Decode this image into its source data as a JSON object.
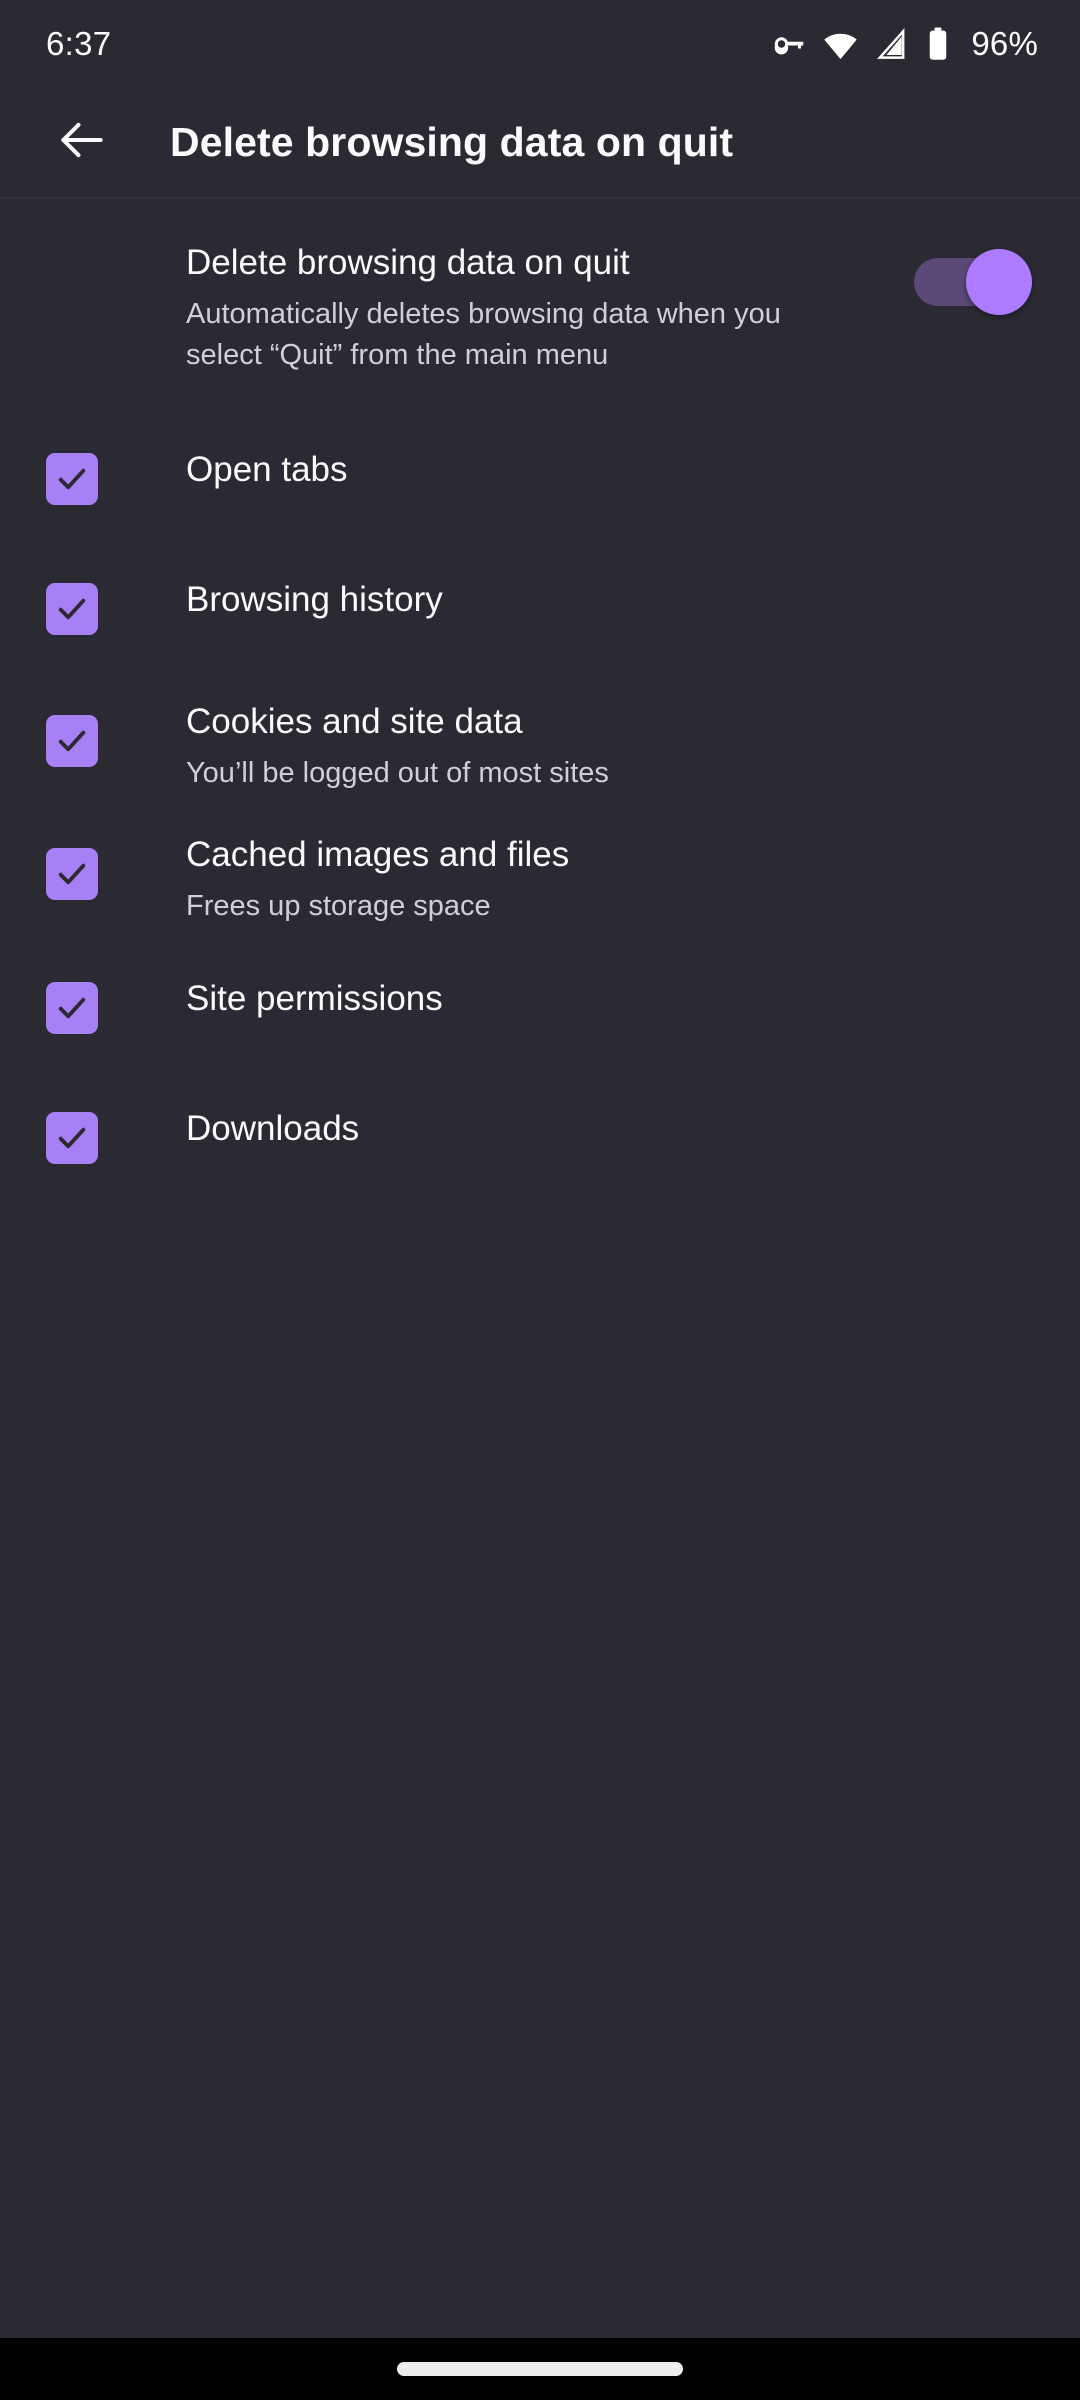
{
  "status_bar": {
    "time": "6:37",
    "battery_percent": "96%",
    "icons": [
      "vpn-key-icon",
      "wifi-icon",
      "cellular-signal-icon",
      "battery-icon"
    ]
  },
  "app_bar": {
    "back_label": "back-arrow",
    "title": "Delete browsing data on quit"
  },
  "master_switch": {
    "title": "Delete browsing data on quit",
    "subtitle": "Automatically deletes browsing data when you select “Quit” from the main menu",
    "enabled": true
  },
  "items": [
    {
      "title": "Open tabs",
      "subtitle": "",
      "checked": true
    },
    {
      "title": "Browsing history",
      "subtitle": "",
      "checked": true
    },
    {
      "title": "Cookies and site data",
      "subtitle": "You’ll be logged out of most sites",
      "checked": true
    },
    {
      "title": "Cached images and files",
      "subtitle": "Frees up storage space",
      "checked": true
    },
    {
      "title": "Site permissions",
      "subtitle": "",
      "checked": true
    },
    {
      "title": "Downloads",
      "subtitle": "",
      "checked": true
    }
  ],
  "colors": {
    "background": "#2B2A33",
    "accent_checkbox": "#A880F5",
    "accent_toggle_thumb": "#AD7BFF",
    "toggle_track": "#5B4A77",
    "text_primary": "#FBFBFE",
    "text_secondary": "#CFCFD8",
    "nav_bar": "#000000"
  },
  "nav_bar": {
    "pill": "gesture-pill"
  }
}
